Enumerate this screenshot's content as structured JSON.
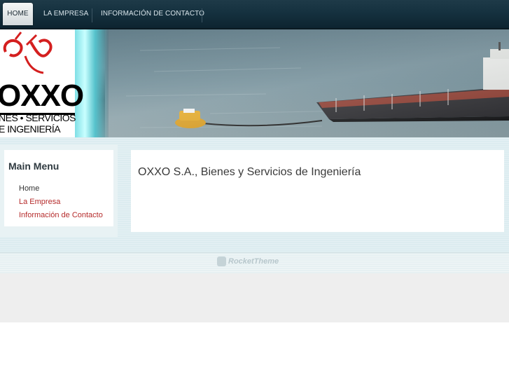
{
  "nav": {
    "items": [
      {
        "label": "HOME"
      },
      {
        "label": "LA EMPRESA"
      },
      {
        "label": "INFORMACIÓN DE CONTACTO"
      }
    ]
  },
  "header": {
    "logo_text": "OXXO",
    "logo_line1": "NES • SERVICIOS",
    "logo_line2": "E INGENIERÍA",
    "logo_accent_color": "#d41f1f"
  },
  "sidebar": {
    "title": "Main Menu",
    "items": [
      {
        "label": "Home"
      },
      {
        "label": "La Empresa"
      },
      {
        "label": "Información de Contacto"
      }
    ]
  },
  "main": {
    "title": "OXXO S.A., Bienes y Servicios de Ingeniería"
  },
  "footer": {
    "credit": "RocketTheme"
  }
}
